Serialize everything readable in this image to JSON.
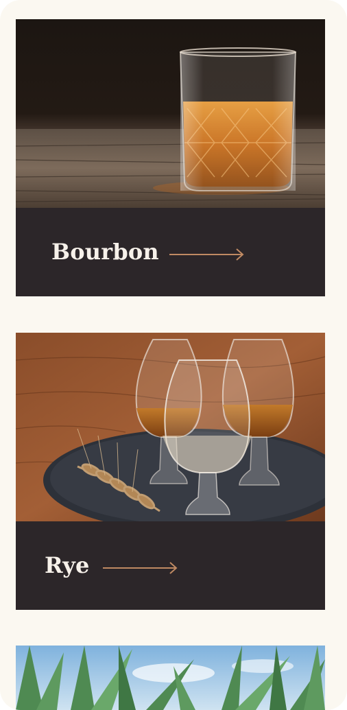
{
  "cards": [
    {
      "label": "Bourbon",
      "image": "bourbon-glass-photo",
      "arrow_icon": "arrow-right-icon"
    },
    {
      "label": "Rye",
      "image": "rye-tasting-glasses-photo",
      "arrow_icon": "arrow-right-icon"
    },
    {
      "label": "",
      "image": "agave-plants-photo"
    }
  ],
  "colors": {
    "background": "#fbf8f1",
    "footer": "#2c2629",
    "label": "#f7f1ea",
    "arrow": "#c08a63"
  }
}
